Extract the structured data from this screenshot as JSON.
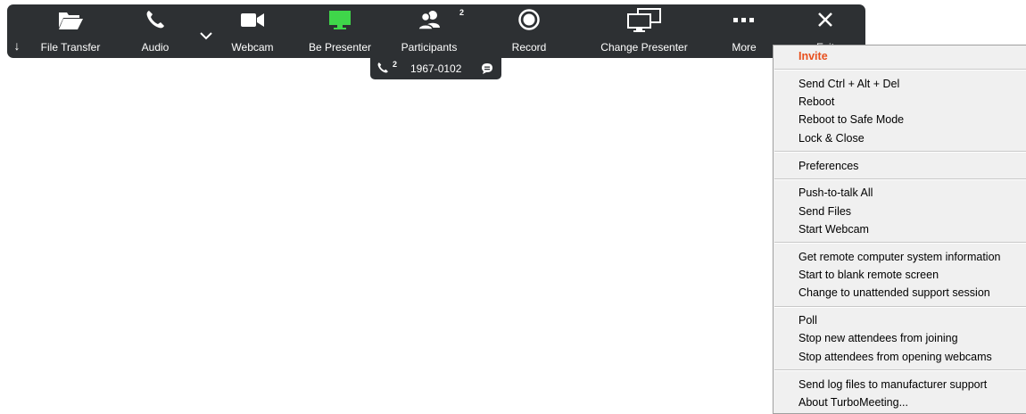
{
  "toolbar": {
    "items": [
      {
        "label": "File Transfer",
        "icon": "folder-open-icon"
      },
      {
        "label": "Audio",
        "icon": "phone-icon"
      },
      {
        "label": "Webcam",
        "icon": "video-camera-icon"
      },
      {
        "label": "Be Presenter",
        "icon": "monitor-icon"
      },
      {
        "label": "Participants",
        "icon": "participants-icon",
        "badge": "2"
      },
      {
        "label": "Record",
        "icon": "record-icon"
      },
      {
        "label": "Change Presenter",
        "icon": "change-presenter-icon"
      },
      {
        "label": "More",
        "icon": "more-dots-icon"
      },
      {
        "label": "Exit",
        "icon": "close-icon"
      }
    ],
    "accent_presenter": "#3fd64a",
    "background": "#2d3033"
  },
  "session": {
    "phone_count": "2",
    "meeting_id": "1967-0102"
  },
  "menu": {
    "highlight_color": "#e8501e",
    "groups": [
      [
        "Invite"
      ],
      [
        "Send Ctrl + Alt + Del",
        "Reboot",
        "Reboot to Safe Mode",
        "Lock & Close"
      ],
      [
        "Preferences"
      ],
      [
        "Push-to-talk All",
        "Send Files",
        "Start Webcam"
      ],
      [
        "Get remote computer system information",
        "Start to blank remote screen",
        "Change to unattended support session"
      ],
      [
        "Poll",
        "Stop new attendees from joining",
        "Stop attendees from opening webcams"
      ],
      [
        "Send log files to manufacturer support",
        "About TurboMeeting..."
      ]
    ]
  }
}
